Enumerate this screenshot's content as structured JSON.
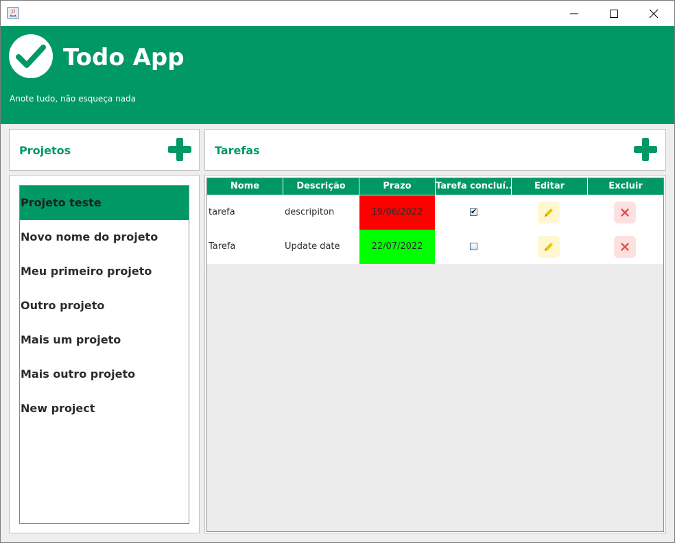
{
  "window": {
    "controls": {
      "minimize": "minimize-icon",
      "maximize": "maximize-icon",
      "close": "close-icon"
    }
  },
  "header": {
    "title": "Todo App",
    "subtitle": "Anote tudo, não esqueça nada",
    "logo_icon": "check-circle-icon"
  },
  "projects": {
    "title": "Projetos",
    "add_icon": "plus-icon",
    "items": [
      {
        "label": "Projeto teste",
        "selected": true
      },
      {
        "label": "Novo nome do projeto",
        "selected": false
      },
      {
        "label": "Meu primeiro projeto",
        "selected": false
      },
      {
        "label": "Outro projeto",
        "selected": false
      },
      {
        "label": "Mais um projeto",
        "selected": false
      },
      {
        "label": "Mais outro projeto",
        "selected": false
      },
      {
        "label": "New project",
        "selected": false
      }
    ]
  },
  "tasks": {
    "title": "Tarefas",
    "add_icon": "plus-icon",
    "columns": [
      "Nome",
      "Descrição",
      "Prazo",
      "Tarefa concluí...",
      "Editar",
      "Excluir"
    ],
    "rows": [
      {
        "name": "tarefa",
        "description": "descripiton",
        "deadline": "19/06/2022",
        "deadline_color": "#ff0000",
        "completed": true,
        "edit_icon": "pencil-icon",
        "delete_icon": "x-icon"
      },
      {
        "name": "Tarefa",
        "description": "Update date",
        "deadline": "22/07/2022",
        "deadline_color": "#00ff00",
        "completed": false,
        "edit_icon": "pencil-icon",
        "delete_icon": "x-icon"
      }
    ]
  },
  "colors": {
    "brand": "#009966",
    "overdue": "#ff0000",
    "on_time": "#00ff00"
  }
}
